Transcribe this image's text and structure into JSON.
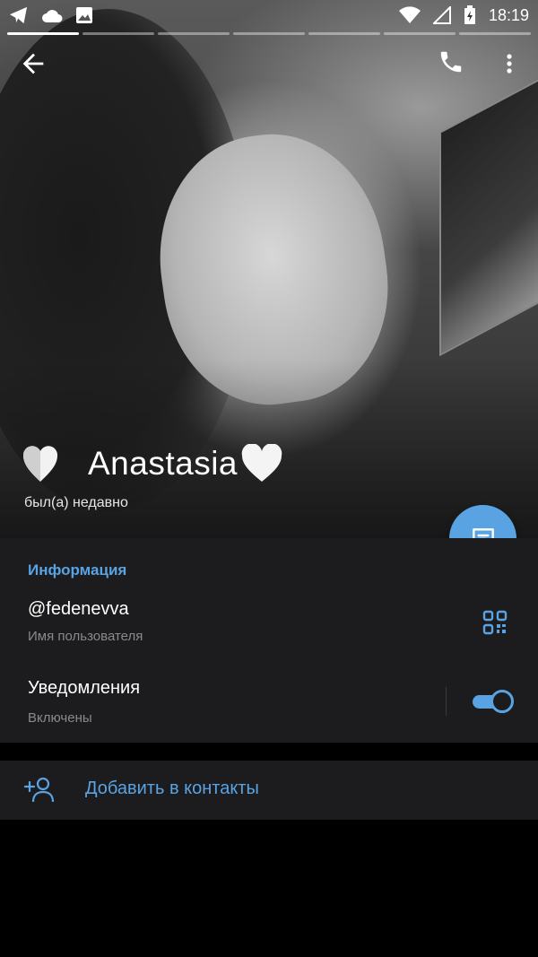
{
  "status_bar": {
    "time": "18:19",
    "icons": [
      "telegram-icon",
      "cloud-icon",
      "image-icon",
      "wifi-icon",
      "signal-icon",
      "battery-charging-icon"
    ]
  },
  "story_progress": {
    "segments": 7,
    "active_segment": 1
  },
  "header": {
    "back_icon": "arrow-left-icon",
    "call_icon": "phone-icon",
    "more_icon": "more-vert-icon"
  },
  "profile": {
    "name": "Anastasia",
    "last_seen": "был(а) недавно",
    "emoji": [
      "white-heart",
      "white-heart"
    ]
  },
  "fab": {
    "icon": "message-icon"
  },
  "info": {
    "section_title": "Информация",
    "username": "@fedenevva",
    "username_caption": "Имя пользователя",
    "notifications_title": "Уведомления",
    "notifications_caption": "Включены",
    "notifications_enabled": true
  },
  "add_contact": {
    "label": "Добавить в контакты",
    "icon": "add-person-icon"
  },
  "colors": {
    "accent": "#5aa3e3",
    "panel": "#1c1c1e",
    "background": "#000000"
  }
}
